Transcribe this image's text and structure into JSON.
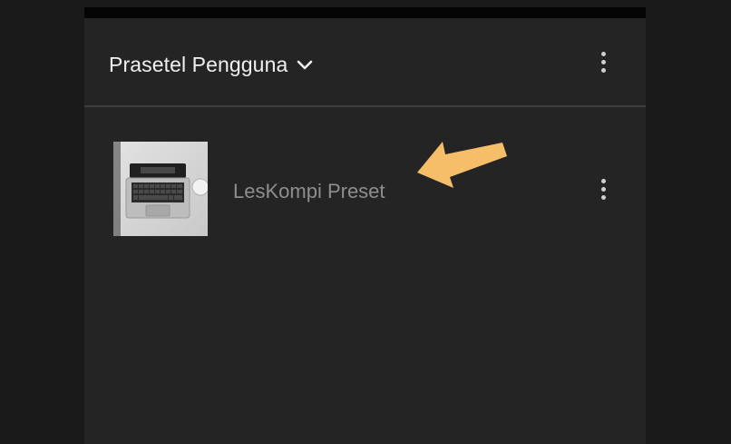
{
  "panel": {
    "title": "Prasetel Pengguna",
    "chevron_icon": "chevron-down-icon",
    "menu_icon": "more-vertical-icon"
  },
  "presets": [
    {
      "name": "LesKompi Preset",
      "thumbnail_icon": "laptop-photo-thumbnail",
      "menu_icon": "more-vertical-icon"
    }
  ],
  "annotation": {
    "arrow_icon": "pointer-arrow-icon",
    "color": "#f7be6a"
  },
  "colors": {
    "panel_bg": "#242424",
    "title_text": "#f0f0f0",
    "preset_text": "#8e8e8e"
  }
}
